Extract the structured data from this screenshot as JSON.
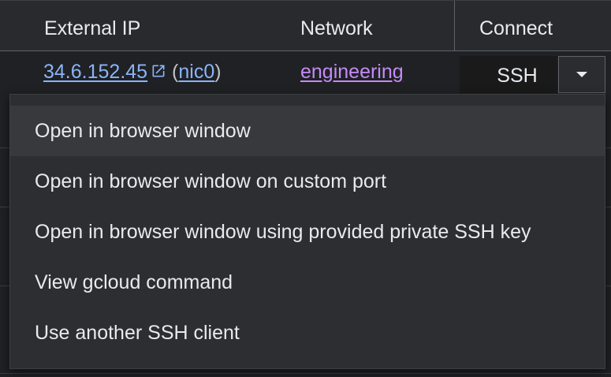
{
  "table": {
    "headers": {
      "external_ip": "External IP",
      "network": "Network",
      "connect": "Connect"
    },
    "row": {
      "ip": "34.6.152.45",
      "paren_open": "(",
      "nic": "nic0",
      "paren_close": ")",
      "network": "engineering",
      "ssh_label": "SSH"
    }
  },
  "menu": {
    "items": [
      {
        "label": "Open in browser window",
        "active": true
      },
      {
        "label": "Open in browser window on custom port"
      },
      {
        "label": "Open in browser window using provided private SSH key"
      },
      {
        "label": "View gcloud command"
      },
      {
        "label": "Use another SSH client"
      }
    ]
  },
  "icons": {
    "external_link": "external-link-icon",
    "dropdown_caret": "caret-down-icon"
  },
  "colors": {
    "background": "#202124",
    "link_blue": "#8ab4f8",
    "link_purple": "#c58af9",
    "menu_background": "#2d2e31",
    "menu_active": "#38393c"
  }
}
